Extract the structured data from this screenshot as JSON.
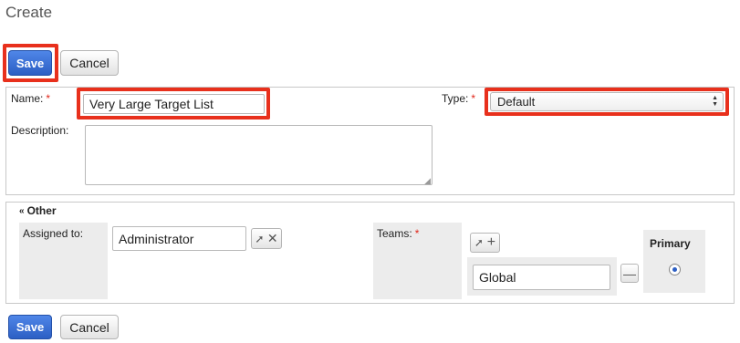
{
  "page": {
    "title": "Create"
  },
  "toolbar_top": {
    "save_label": "Save",
    "cancel_label": "Cancel"
  },
  "form": {
    "name_label": "Name:",
    "required_mark": "*",
    "name_value": "Very Large Target List",
    "type_label": "Type:",
    "type_value": "Default",
    "description_label": "Description:",
    "description_value": ""
  },
  "other": {
    "section_label": "Other",
    "assigned_label": "Assigned to:",
    "assigned_value": "Administrator",
    "teams_label": "Teams:",
    "team_value": "Global",
    "primary_label": "Primary"
  },
  "toolbar_bottom": {
    "save_label": "Save",
    "cancel_label": "Cancel"
  },
  "colors": {
    "accent": "#2c5fc4",
    "highlight": "#e8301c",
    "required": "#e0261a"
  }
}
